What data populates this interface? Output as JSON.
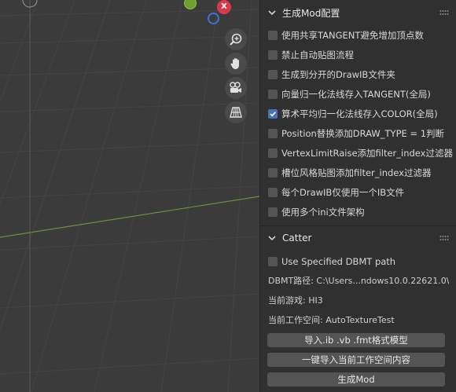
{
  "viewport": {
    "gizmo": {
      "x_label": "X"
    },
    "nav_tools": [
      "zoom-icon",
      "hand-icon",
      "camera-icon",
      "grid-view-icon"
    ]
  },
  "sidebar": {
    "panel1": {
      "title": "生成Mod配置",
      "options": [
        {
          "label": "使用共享TANGENT避免增加顶点数",
          "checked": false
        },
        {
          "label": "禁止自动贴图流程",
          "checked": false
        },
        {
          "label": "生成到分开的DrawIB文件夹",
          "checked": false
        },
        {
          "label": "向量归一化法线存入TANGENT(全局)",
          "checked": false
        },
        {
          "label": "算术平均归一化法线存入COLOR(全局)",
          "checked": true
        },
        {
          "label": "Position替换添加DRAW_TYPE = 1判断",
          "checked": false
        },
        {
          "label": "VertexLimitRaise添加filter_index过滤器",
          "checked": false
        },
        {
          "label": "槽位风格贴图添加filter_index过滤器",
          "checked": false
        },
        {
          "label": "每个DrawIB仅使用一个IB文件",
          "checked": false
        },
        {
          "label": "使用多个ini文件架构",
          "checked": false
        }
      ]
    },
    "panel2": {
      "title": "Catter",
      "use_specified_label": "Use Specified DBMT path",
      "use_specified_checked": false,
      "dbmt_path": "DBMT路径: C:\\Users...ndows10.0.22621.0\\",
      "current_game": "当前游戏: HI3",
      "current_workspace": "当前工作空间: AutoTextureTest",
      "buttons": {
        "import_model": "导入.ib .vb .fmt格式模型",
        "import_workspace": "一键导入当前工作空间内容",
        "generate_mod": "生成Mod"
      }
    }
  }
}
